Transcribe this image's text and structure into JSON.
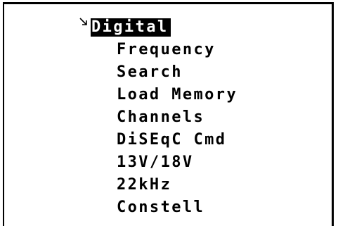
{
  "menu": {
    "selected_index": 0,
    "items": [
      {
        "label": "Digital"
      },
      {
        "label": "Frequency"
      },
      {
        "label": "Search"
      },
      {
        "label": "Load Memory"
      },
      {
        "label": "Channels"
      },
      {
        "label": "DiSEqC Cmd"
      },
      {
        "label": "13V/18V"
      },
      {
        "label": "22kHz"
      },
      {
        "label": "Constell"
      }
    ]
  },
  "icons": {
    "cursor": "arrow-pointer-icon"
  },
  "colors": {
    "background": "#ffffff",
    "foreground": "#000000",
    "highlight": "#000000",
    "highlight_text": "#ffffff"
  }
}
